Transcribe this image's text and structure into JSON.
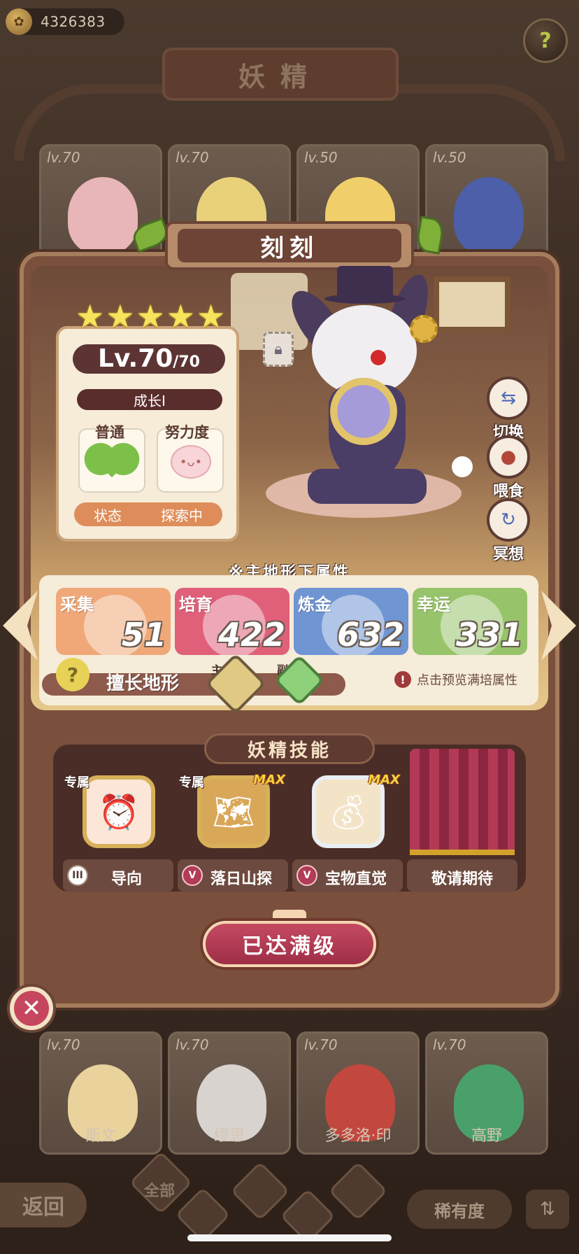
{
  "top": {
    "coins": "4326383",
    "title": "妖精",
    "help_icon": "question-sprout-icon"
  },
  "background_cards_top": [
    {
      "level": "lv.70",
      "color": "#e8b6b8"
    },
    {
      "level": "lv.70",
      "color": "#e9d17a"
    },
    {
      "level": "lv.50",
      "color": "#f0cf6a"
    },
    {
      "level": "lv.50",
      "color": "#4c5fa8"
    }
  ],
  "background_cards_bottom": [
    {
      "level": "lv.70",
      "name": "斯文",
      "color": "#e9d29c"
    },
    {
      "level": "lv.70",
      "name": "缪恩",
      "color": "#d8d3cf"
    },
    {
      "level": "lv.70",
      "name": "多多洛·印",
      "color": "#c2483f"
    },
    {
      "level": "lv.70",
      "name": "高野",
      "color": "#4aa06a"
    }
  ],
  "fairy": {
    "name": "刻刻",
    "stars": 5,
    "level": "Lv.70",
    "max_level": "/70",
    "growth": "成长I",
    "attr_type_label": "普通",
    "effort_label": "努力度",
    "status_label": "状态",
    "status_value": "探索中"
  },
  "side_buttons": [
    {
      "label": "切换",
      "icon": "swap-icon"
    },
    {
      "label": "喂食",
      "icon": "meat-icon"
    },
    {
      "label": "冥想",
      "icon": "meditate-icon"
    }
  ],
  "stats": {
    "title": "※主地形下属性",
    "items": [
      {
        "name": "采集",
        "value": "51",
        "color": "#f0a878"
      },
      {
        "name": "培育",
        "value": "422",
        "color": "#e0607a"
      },
      {
        "name": "炼金",
        "value": "632",
        "color": "#6f95d3"
      },
      {
        "name": "幸运",
        "value": "331",
        "color": "#97c46a"
      }
    ],
    "terrain_label": "擅长地形",
    "main_tag": "主",
    "sub_tag": "副",
    "preview_text": "点击预览满培属性"
  },
  "skills": {
    "header": "妖精技能",
    "items": [
      {
        "name": "导向",
        "rank": "III",
        "tag": "专属",
        "max": "",
        "icon": "alarm-clock-icon"
      },
      {
        "name": "落日山探",
        "rank": "V",
        "tag": "专属",
        "max": "MAX",
        "icon": "treasure-map-icon"
      },
      {
        "name": "宝物直觉",
        "rank": "V",
        "tag": "",
        "max": "MAX",
        "icon": "money-bag-icon"
      },
      {
        "name": "敬请期待",
        "rank": "",
        "tag": "",
        "max": "",
        "icon": "curtain-icon"
      }
    ]
  },
  "maxed_button": "已达满级",
  "bottom": {
    "back": "返回",
    "filter_all": "全部",
    "rarity": "稀有度",
    "sort_icon": "sort-icon"
  }
}
